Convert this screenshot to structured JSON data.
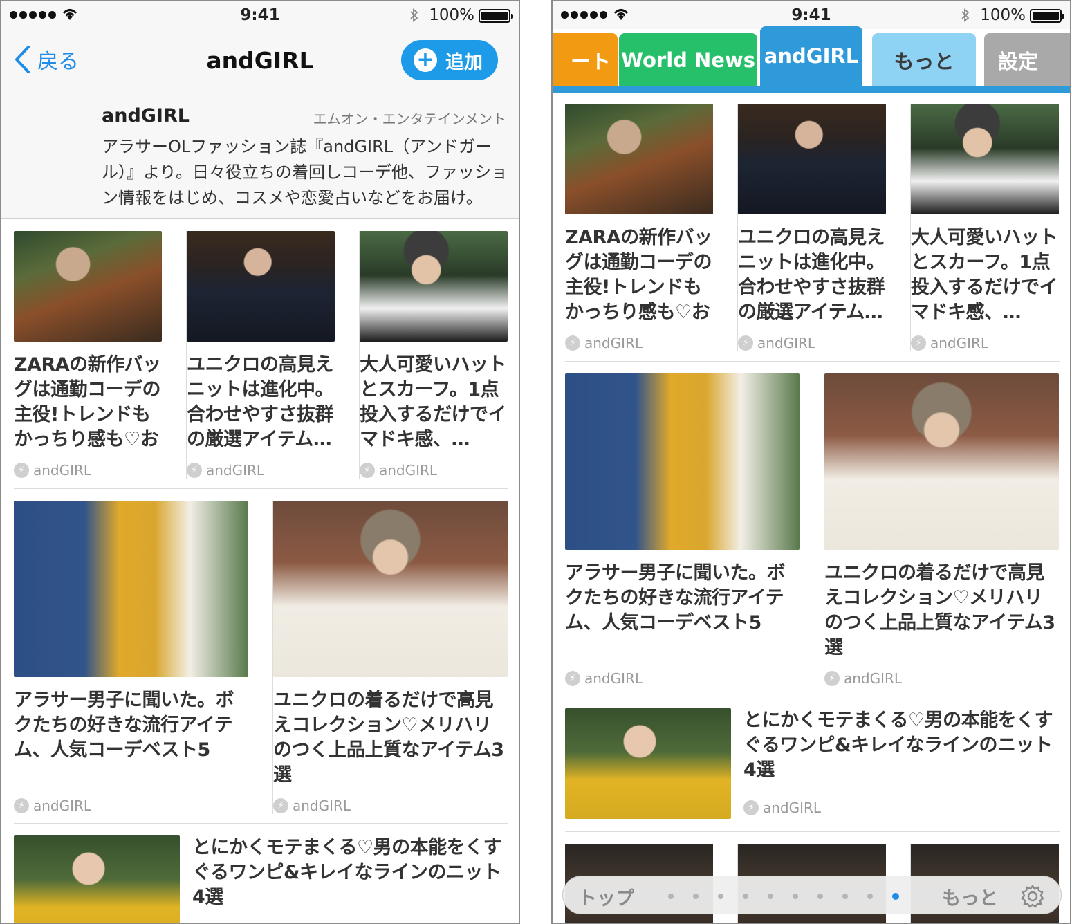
{
  "status": {
    "time": "9:41",
    "battery": "100%",
    "battery_level": 1.0
  },
  "left": {
    "nav": {
      "back_label": "戻る",
      "title": "andGIRL",
      "add_label": "追加"
    },
    "publisher": {
      "name": "andGIRL",
      "company": "エムオン・エンタテインメント",
      "description": "アラサーOLファッション誌『andGIRL（アンドガール）』より。日々役立ちの着回しコーデ他、ファッション情報をはじめ、コスメや恋愛占いなどをお届け。"
    }
  },
  "right": {
    "tabs": [
      {
        "label": "ート",
        "color": "#f39a13"
      },
      {
        "label": "World News",
        "color": "#26c06a"
      },
      {
        "label": "andGIRL",
        "color": "#2f9ad9",
        "active": true
      },
      {
        "label": "もっと",
        "color": "#8fd3f4"
      },
      {
        "label": "設定",
        "color": "#a9a9a9"
      }
    ],
    "pagebar": {
      "top_label": "トップ",
      "more_label": "もっと",
      "dots": 10,
      "active_dot": 10
    }
  },
  "articles": [
    {
      "title": "ZARAの新作バッグは通勤コーデの主役!トレンドもかっちり感も♡お仕事…",
      "source": "andGIRL"
    },
    {
      "title": "ユニクロの高見えニットは進化中。合わせやすさ抜群の厳選アイテム…",
      "source": "andGIRL"
    },
    {
      "title": "大人可愛いハットとスカーフ。1点投入するだけでイマドキ感、…",
      "source": "andGIRL"
    },
    {
      "title": "アラサー男子に聞いた。ボクたちの好きな流行アイテム、人気コーデベスト5",
      "source": "andGIRL"
    },
    {
      "title": "ユニクロの着るだけで高見えコレクション♡メリハリのつく上品上質なアイテム3選",
      "source": "andGIRL"
    },
    {
      "title": "とにかくモテまくる♡男の本能をくすぐるワンピ&キレイなラインのニット4選",
      "source": "andGIRL"
    }
  ],
  "colors": {
    "accent": "#1e9be8",
    "link": "#1e8ce8",
    "tab_strip": "#2f9ad9",
    "source_gray": "#9a9a9a"
  }
}
